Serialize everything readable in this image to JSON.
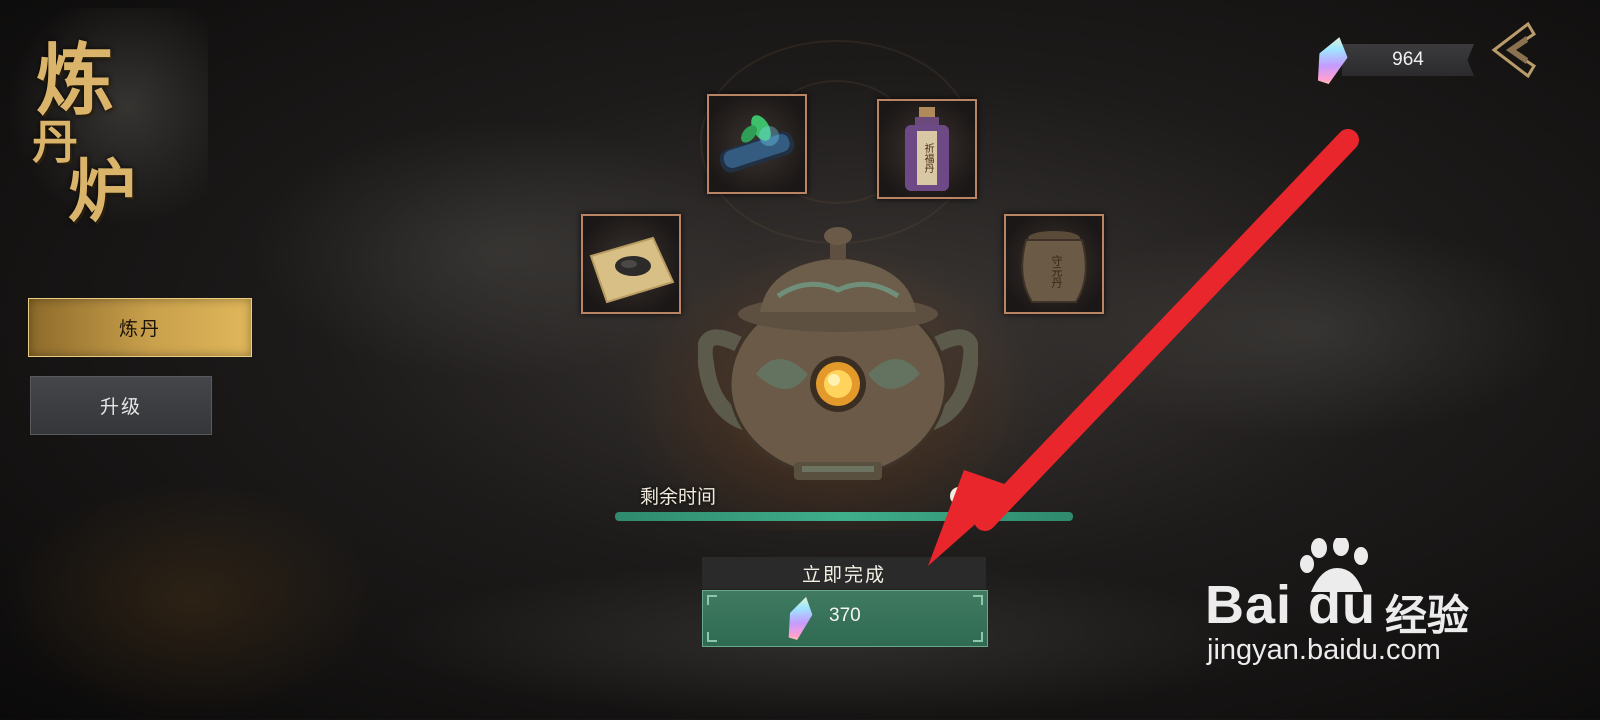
{
  "title": {
    "line1": "炼",
    "line2": "丹",
    "line3": "炉"
  },
  "side_menu": {
    "alchemy_label": "炼丹",
    "upgrade_label": "升级"
  },
  "currency": {
    "icon": "crystal-icon",
    "amount": "964"
  },
  "materials": [
    {
      "name": "scroll-with-herb-icon"
    },
    {
      "name": "purple-potion-bottle-icon",
      "label": "祈福丹"
    },
    {
      "name": "powder-on-paper-icon"
    },
    {
      "name": "clay-jar-icon",
      "label": "守元丹"
    }
  ],
  "furnace": {
    "name": "alchemy-furnace-image"
  },
  "timer": {
    "label": "剩余时间",
    "value_visible": "59分",
    "progress": 1.0
  },
  "complete_now": {
    "label": "立即完成",
    "cost": "370",
    "cost_icon": "crystal-icon"
  },
  "watermark": {
    "brand": "Bai du",
    "cn": "经验",
    "url": "jingyan.baidu.com"
  },
  "colors": {
    "accent_gold": "#c9a04c",
    "progress_green": "#3fae8a",
    "button_green": "#2f6a52",
    "arrow_red": "#e8262b"
  }
}
